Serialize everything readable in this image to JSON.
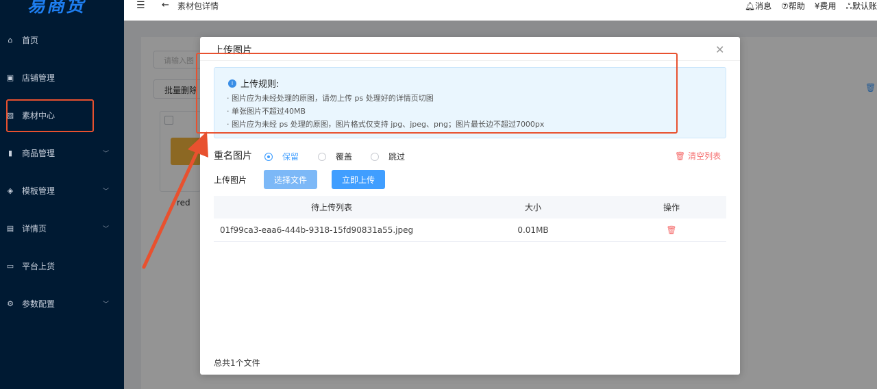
{
  "app": {
    "logo": "易商货"
  },
  "sidebar": {
    "items": [
      {
        "label": "首页",
        "icon": "home-icon",
        "glyph": "⌂",
        "has_children": false
      },
      {
        "label": "店铺管理",
        "icon": "shop-icon",
        "glyph": "▣",
        "has_children": false
      },
      {
        "label": "素材中心",
        "icon": "image-icon",
        "glyph": "▨",
        "has_children": false
      },
      {
        "label": "商品管理",
        "icon": "chart-icon",
        "glyph": "▮",
        "has_children": true
      },
      {
        "label": "模板管理",
        "icon": "layers-icon",
        "glyph": "◈",
        "has_children": true
      },
      {
        "label": "详情页",
        "icon": "document-icon",
        "glyph": "▤",
        "has_children": true
      },
      {
        "label": "平台上货",
        "icon": "store-icon",
        "glyph": "▭",
        "has_children": false
      },
      {
        "label": "参数配置",
        "icon": "settings-icon",
        "glyph": "⚙",
        "has_children": true
      }
    ]
  },
  "topbar": {
    "breadcrumb": "素材包详情",
    "messages": "消息",
    "help": "帮助",
    "fees": "费用",
    "account": "默认账"
  },
  "background": {
    "search_placeholder": "请输入图",
    "batch_delete": "批量删除",
    "folder_name": "red"
  },
  "dialog": {
    "title": "上传图片",
    "rules": {
      "heading": "上传规则:",
      "lines": [
        "· 图片应为未经处理的原图，请勿上传 ps 处理好的详情页切图",
        "· 单张图片不超过40MB",
        "· 图片应为未经 ps 处理的原图，图片格式仅支持 jpg、jpeg、png；图片最长边不超过7000px"
      ]
    },
    "duplicate": {
      "label": "重名图片",
      "options": [
        "保留",
        "覆盖",
        "跳过"
      ],
      "selected": "保留"
    },
    "clear_list": "清空列表",
    "upload": {
      "label": "上传图片",
      "choose_button": "选择文件",
      "upload_button": "立即上传"
    },
    "table": {
      "columns": [
        "待上传列表",
        "大小",
        "操作"
      ],
      "rows": [
        {
          "name": "01f99ca3-eaa6-444b-9318-15fd90831a55.jpeg",
          "size": "0.01MB"
        }
      ]
    },
    "total": "总共1个文件"
  },
  "colors": {
    "sidebar_bg": "#001a33",
    "primary": "#409eff",
    "danger": "#f56c6c",
    "annotation": "#e8512f"
  }
}
